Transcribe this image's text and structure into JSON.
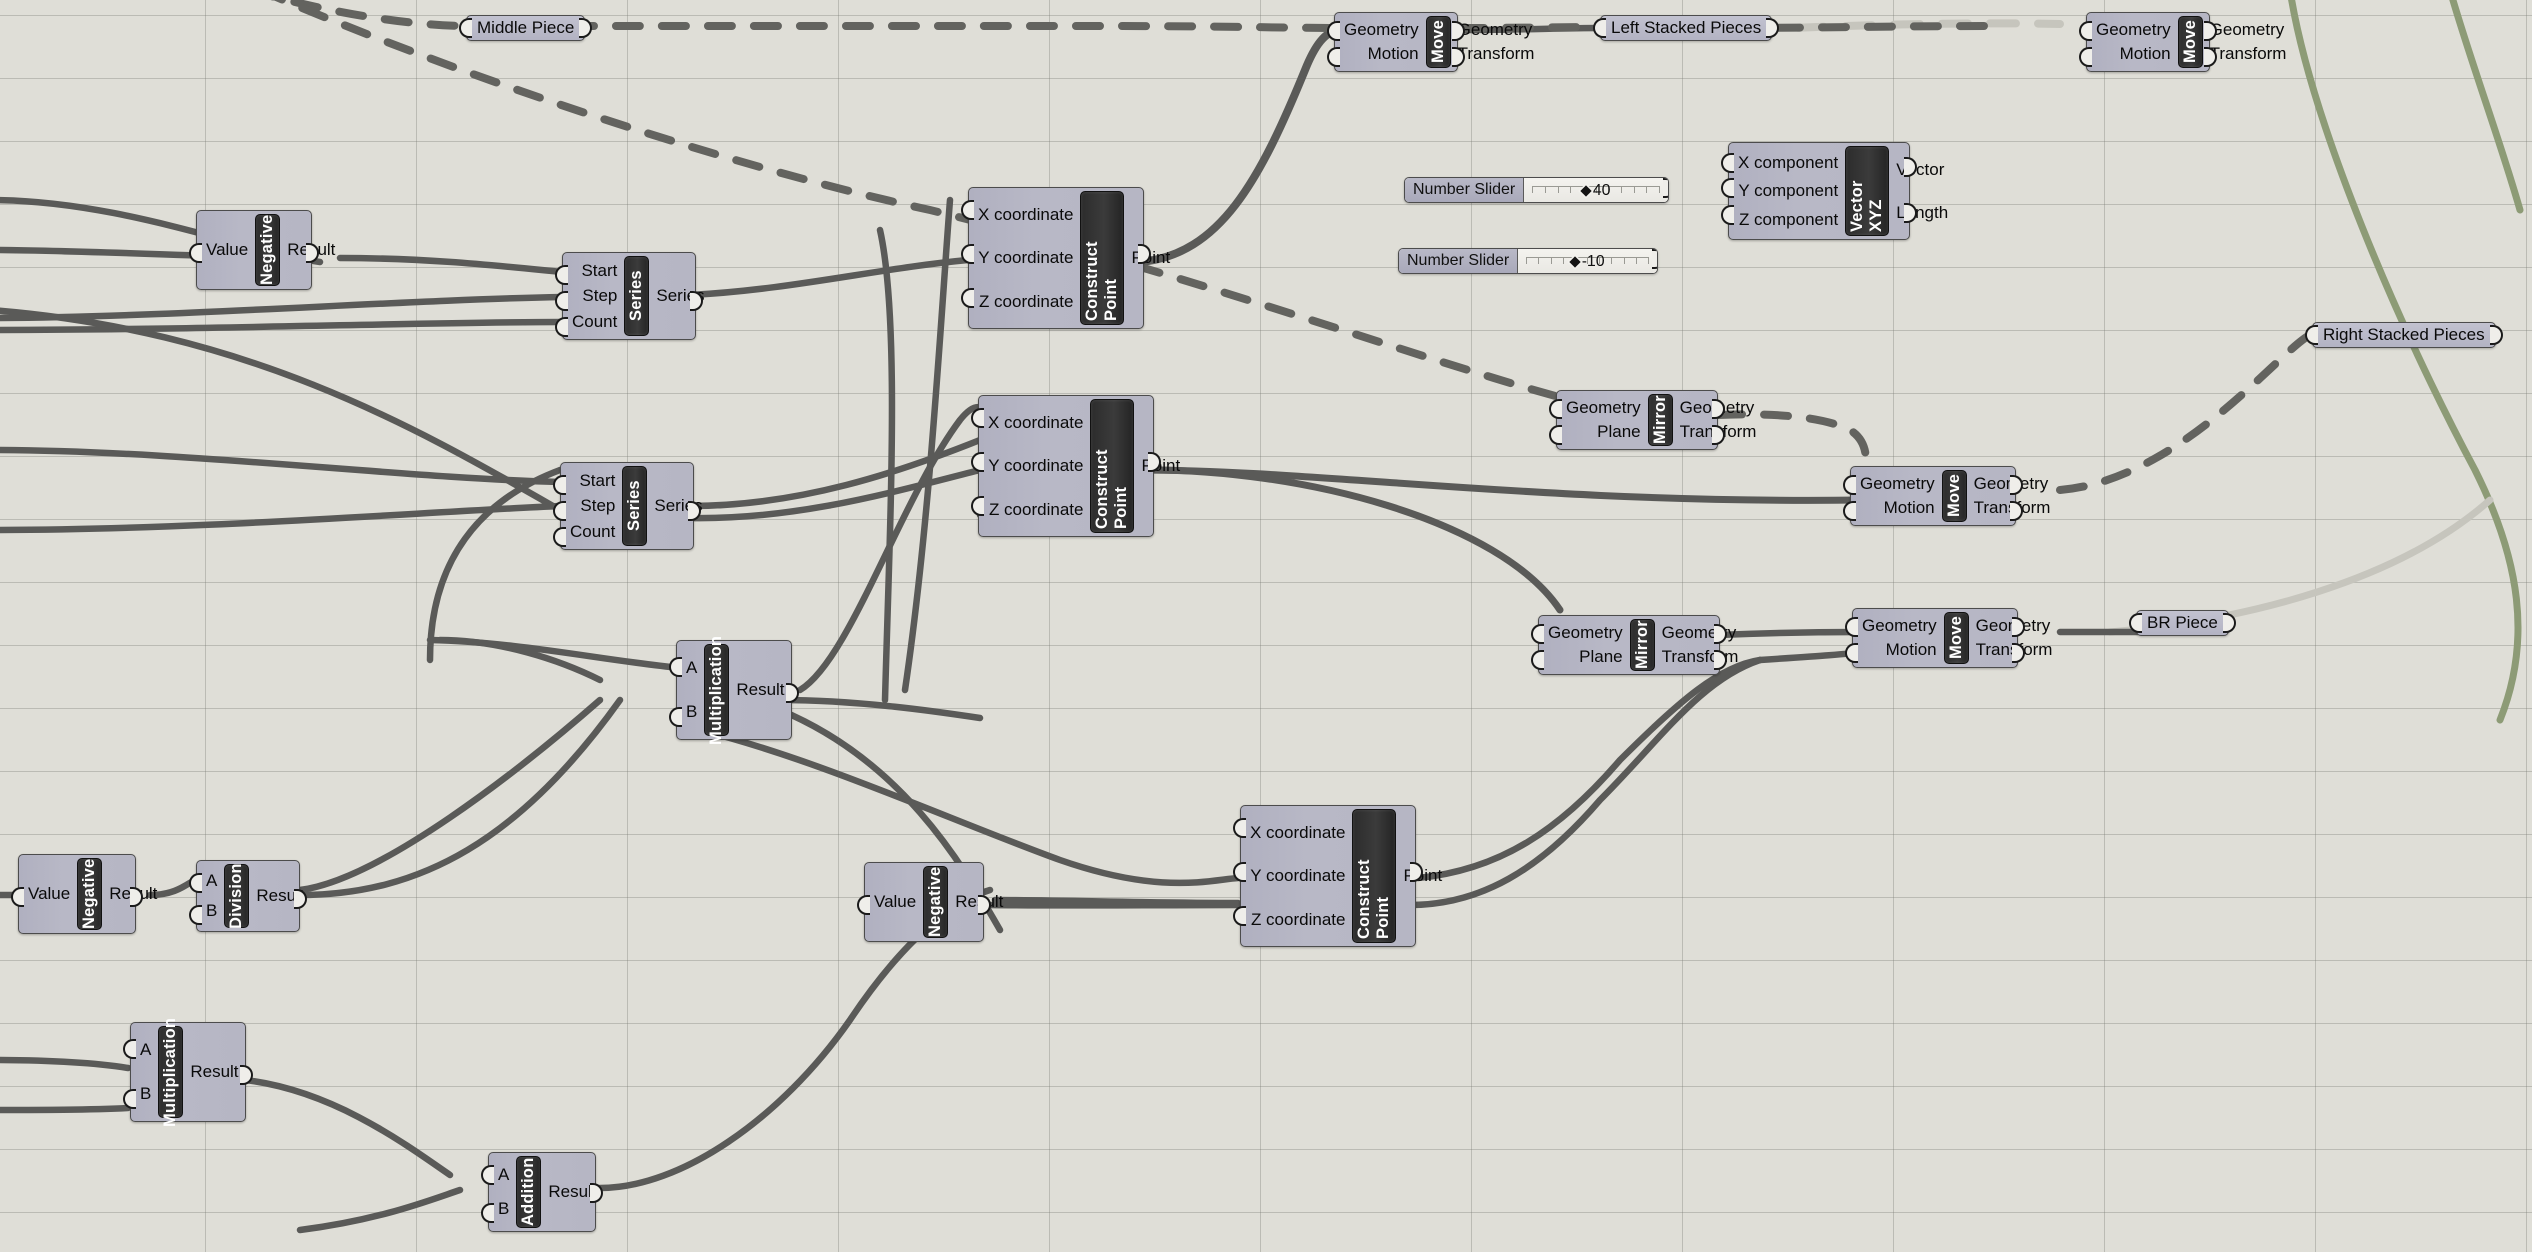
{
  "app": {
    "kind": "node-graph-canvas",
    "background": "#dfded7",
    "grid_color": "#78786f",
    "wire_color": "#595959",
    "wire_color_light": "#b9b8b1",
    "wire_color_green": "#8d9b76"
  },
  "components": [
    {
      "id": "series_top",
      "name": "Series",
      "inputs": [
        "Start",
        "Step",
        "Count"
      ],
      "outputs": [
        "Series"
      ]
    },
    {
      "id": "series_mid",
      "name": "Series",
      "inputs": [
        "Start",
        "Step",
        "Count"
      ],
      "outputs": [
        "Series"
      ]
    },
    {
      "id": "negative_a",
      "name": "Negative",
      "inputs": [
        "Value"
      ],
      "outputs": [
        "Result"
      ]
    },
    {
      "id": "negative_b",
      "name": "Negative",
      "inputs": [
        "Value"
      ],
      "outputs": [
        "Result"
      ]
    },
    {
      "id": "negative_c",
      "name": "Negative",
      "inputs": [
        "Value"
      ],
      "outputs": [
        "Result"
      ]
    },
    {
      "id": "cpoint_top",
      "name": "Construct Point",
      "inputs": [
        "X coordinate",
        "Y coordinate",
        "Z coordinate"
      ],
      "outputs": [
        "Point"
      ]
    },
    {
      "id": "cpoint_mid",
      "name": "Construct Point",
      "inputs": [
        "X coordinate",
        "Y coordinate",
        "Z coordinate"
      ],
      "outputs": [
        "Point"
      ]
    },
    {
      "id": "cpoint_low",
      "name": "Construct Point",
      "inputs": [
        "X coordinate",
        "Y coordinate",
        "Z coordinate"
      ],
      "outputs": [
        "Point"
      ]
    },
    {
      "id": "mult_mid",
      "name": "Multiplication",
      "inputs": [
        "A",
        "B"
      ],
      "outputs": [
        "Result"
      ]
    },
    {
      "id": "mult_low",
      "name": "Multiplication",
      "inputs": [
        "A",
        "B"
      ],
      "outputs": [
        "Result"
      ]
    },
    {
      "id": "division",
      "name": "Division",
      "inputs": [
        "A",
        "B"
      ],
      "outputs": [
        "Result"
      ]
    },
    {
      "id": "addition",
      "name": "Addition",
      "inputs": [
        "A",
        "B"
      ],
      "outputs": [
        "Result"
      ]
    },
    {
      "id": "move_top_left",
      "name": "Move",
      "inputs": [
        "Geometry",
        "Motion"
      ],
      "outputs": [
        "Geometry",
        "Transform"
      ]
    },
    {
      "id": "move_top_right",
      "name": "Move",
      "inputs": [
        "Geometry",
        "Motion"
      ],
      "outputs": [
        "Geometry",
        "Transform"
      ]
    },
    {
      "id": "move_mid",
      "name": "Move",
      "inputs": [
        "Geometry",
        "Motion"
      ],
      "outputs": [
        "Geometry",
        "Transform"
      ]
    },
    {
      "id": "move_low",
      "name": "Move",
      "inputs": [
        "Geometry",
        "Motion"
      ],
      "outputs": [
        "Geometry",
        "Transform"
      ]
    },
    {
      "id": "mirror_mid",
      "name": "Mirror",
      "inputs": [
        "Geometry",
        "Plane"
      ],
      "outputs": [
        "Geometry",
        "Transform"
      ]
    },
    {
      "id": "mirror_low",
      "name": "Mirror",
      "inputs": [
        "Geometry",
        "Plane"
      ],
      "outputs": [
        "Geometry",
        "Transform"
      ]
    },
    {
      "id": "vector_xyz",
      "name": "Vector XYZ",
      "inputs": [
        "X component",
        "Y component",
        "Z component"
      ],
      "outputs": [
        "Vector",
        "Length"
      ]
    }
  ],
  "capsules": [
    {
      "id": "middle_piece",
      "label": "Middle Piece"
    },
    {
      "id": "left_stacked_pieces",
      "label": "Left Stacked Pieces"
    },
    {
      "id": "right_stacked_pieces",
      "label": "Right Stacked Pieces"
    },
    {
      "id": "br_piece",
      "label": "BR Piece"
    }
  ],
  "sliders": [
    {
      "id": "slider_40",
      "label": "Number Slider",
      "value": "40",
      "handle_pct": 47
    },
    {
      "id": "slider_m10",
      "label": "Number Slider",
      "value": "-10",
      "handle_pct": 44
    }
  ]
}
